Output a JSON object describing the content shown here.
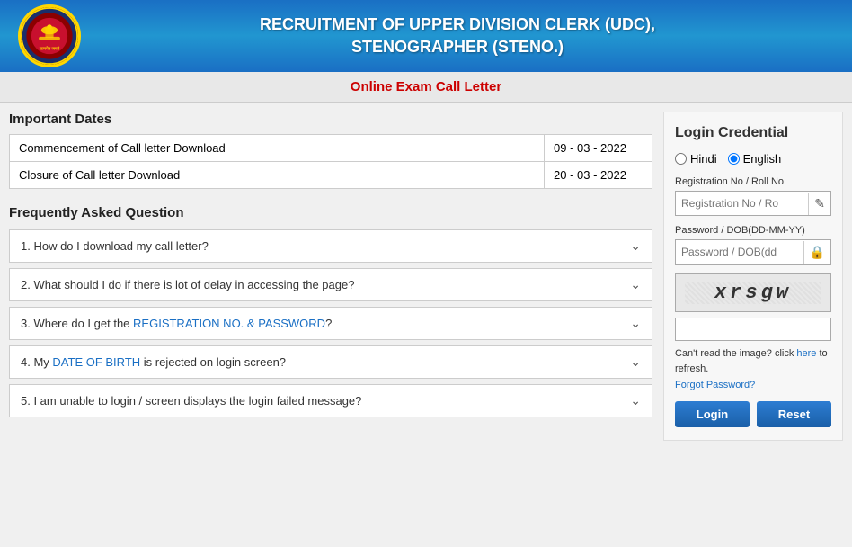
{
  "header": {
    "title_line1": "RECRUITMENT OF UPPER DIVISION CLERK (UDC),",
    "title_line2": "STENOGRAPHER (STENO.)"
  },
  "banner": {
    "text": "Online Exam Call Letter"
  },
  "important_dates": {
    "section_title": "Important Dates",
    "rows": [
      {
        "label": "Commencement of Call letter Download",
        "date": "09 - 03 - 2022"
      },
      {
        "label": "Closure of Call letter Download",
        "date": "20 - 03 - 2022"
      }
    ]
  },
  "faq": {
    "section_title": "Frequently Asked Question",
    "items": [
      {
        "number": "1.",
        "text": "How do I download my call letter?"
      },
      {
        "number": "2.",
        "text": "What should I do if there is lot of delay in accessing the page?"
      },
      {
        "number": "3.",
        "text": "Where do I get the REGISTRATION NO. & PASSWORD?",
        "highlight": "REGISTRATION NO. & PASSWORD"
      },
      {
        "number": "4.",
        "text": "My DATE OF BIRTH is rejected on login screen?",
        "highlight": "DATE OF BIRTH"
      },
      {
        "number": "5.",
        "text": "I am unable to login / screen displays the login failed message?"
      }
    ]
  },
  "login": {
    "title": "Login Credential",
    "language_options": [
      "Hindi",
      "English"
    ],
    "selected_language": "English",
    "field_reg_label": "Registration No / Roll No",
    "field_reg_placeholder": "Registration No / Ro",
    "field_pass_label": "Password / DOB(DD-MM-YY)",
    "field_pass_placeholder": "Password / DOB(dd",
    "captcha_value": "xrsgw",
    "cant_read_text1": "Can't read the image? click",
    "cant_read_link": "here",
    "cant_read_text2": "to refresh.",
    "forgot_password_text": "Forgot Password?",
    "btn_login": "Login",
    "btn_reset": "Reset"
  }
}
